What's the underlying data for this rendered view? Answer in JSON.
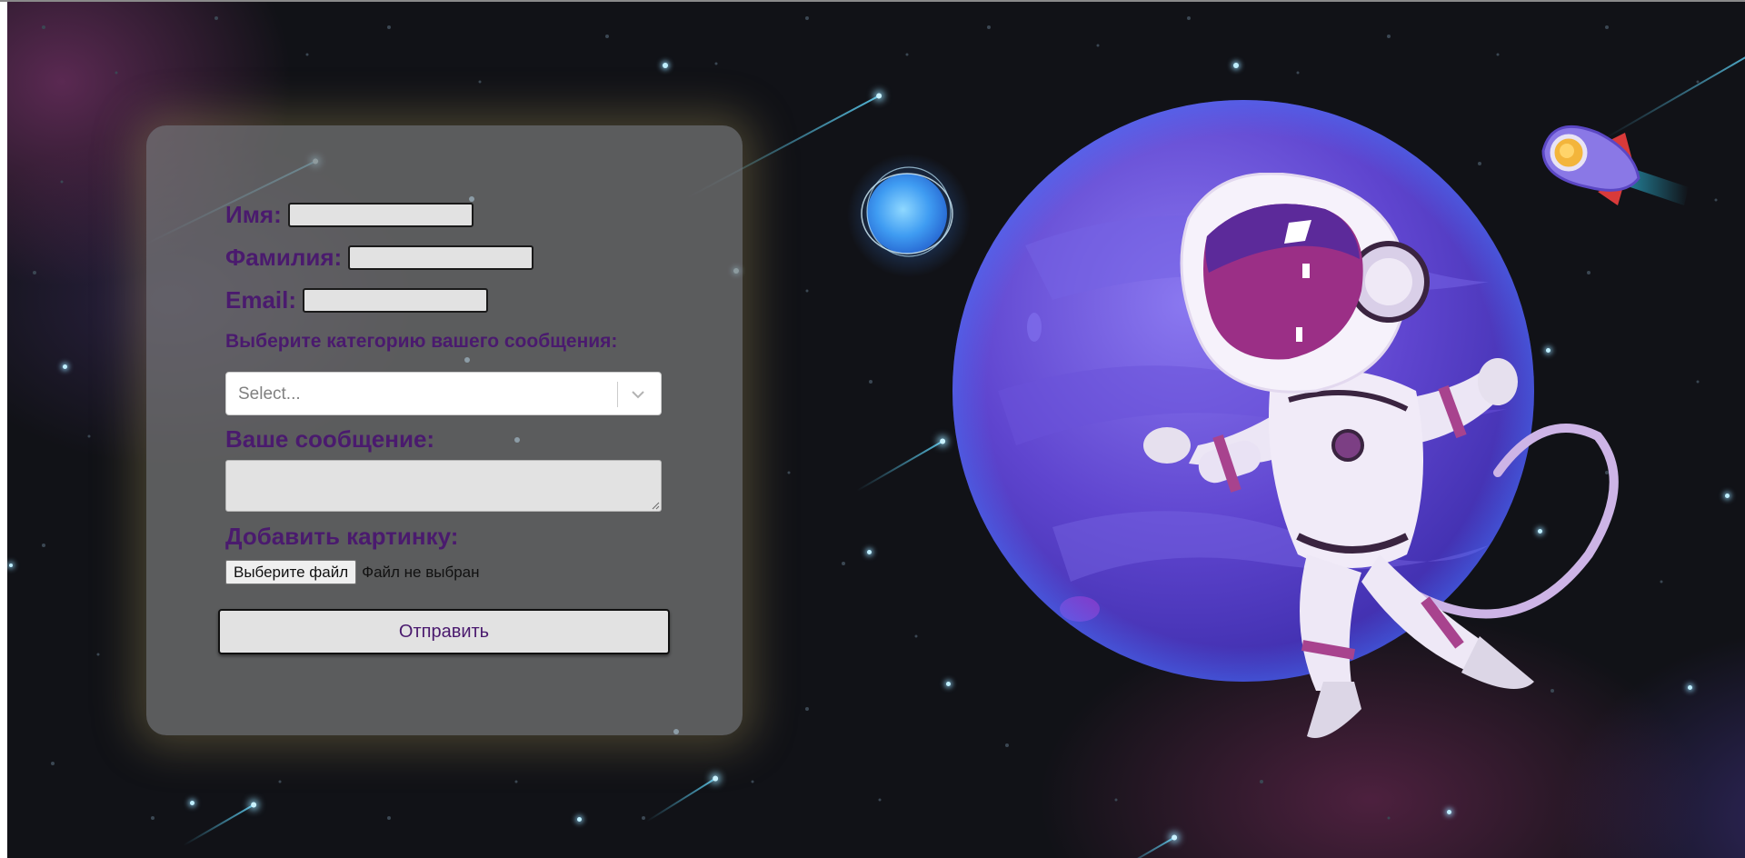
{
  "form": {
    "first_name_label": "Имя:",
    "first_name_value": "",
    "last_name_label": "Фамилия:",
    "last_name_value": "",
    "email_label": "Email:",
    "email_value": "",
    "category_label": "Выберите категорию вашего сообщения:",
    "category_placeholder": "Select...",
    "message_label": "Ваше сообщение:",
    "message_value": "",
    "image_label": "Добавить картинку:",
    "file_button_label": "Выберите файл",
    "file_status": "Файл не выбран",
    "submit_label": "Отправить"
  },
  "illustration": {
    "icons": [
      "astronaut-illustration",
      "planet-illustration",
      "glowing-moon-illustration",
      "rocket-illustration"
    ]
  },
  "colors": {
    "label_text": "#4a1a6e",
    "background": "#111217",
    "card": "#787878",
    "planet": "#6a4fd6"
  }
}
